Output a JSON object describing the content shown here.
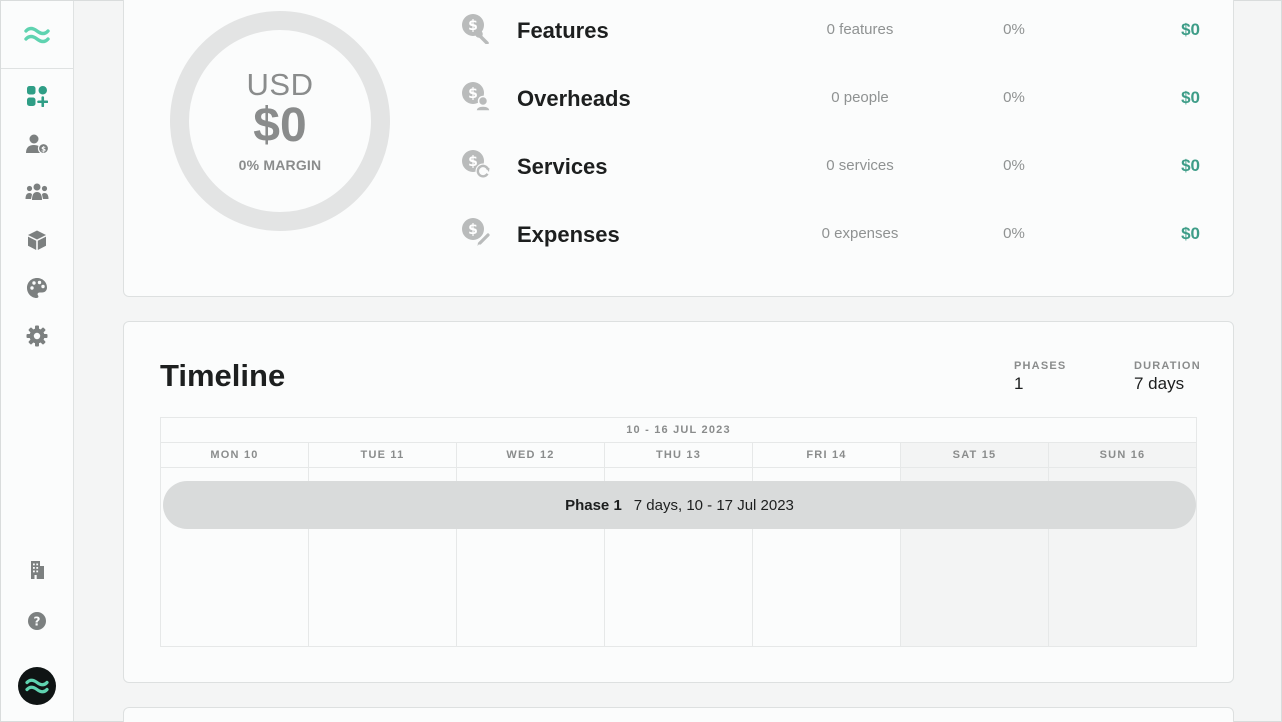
{
  "sidebar": {
    "logo_icon": "wave-logo-icon",
    "items": [
      {
        "name": "dashboard-icon"
      },
      {
        "name": "user-billing-icon"
      },
      {
        "name": "team-icon"
      },
      {
        "name": "box-icon"
      },
      {
        "name": "palette-icon"
      },
      {
        "name": "settings-icon"
      }
    ],
    "bottom_items": [
      {
        "name": "building-icon"
      },
      {
        "name": "help-icon"
      }
    ],
    "avatar_icon": "wave-logo-icon"
  },
  "summary": {
    "currency": "USD",
    "total": "$0",
    "margin": "0% MARGIN",
    "rows": [
      {
        "icon": "dollar-wrench-icon",
        "name": "Features",
        "count": "0 features",
        "pct": "0%",
        "value": "$0"
      },
      {
        "icon": "dollar-person-icon",
        "name": "Overheads",
        "count": "0 people",
        "pct": "0%",
        "value": "$0"
      },
      {
        "icon": "dollar-refresh-icon",
        "name": "Services",
        "count": "0 services",
        "pct": "0%",
        "value": "$0"
      },
      {
        "icon": "dollar-pencil-icon",
        "name": "Expenses",
        "count": "0 expenses",
        "pct": "0%",
        "value": "$0"
      }
    ]
  },
  "timeline": {
    "title": "Timeline",
    "phases_label": "PHASES",
    "phases_value": "1",
    "duration_label": "DURATION",
    "duration_value": "7 days",
    "week_label": "10 - 16 JUL 2023",
    "days": [
      "MON 10",
      "TUE 11",
      "WED 12",
      "THU 13",
      "FRI 14",
      "SAT 15",
      "SUN 16"
    ],
    "phase": {
      "name": "Phase 1",
      "detail": "7 days, 10 - 17 Jul 2023"
    }
  },
  "colors": {
    "accent": "#3e9d88",
    "logo": "#5fd3b0",
    "muted": "#8a8c8c"
  }
}
